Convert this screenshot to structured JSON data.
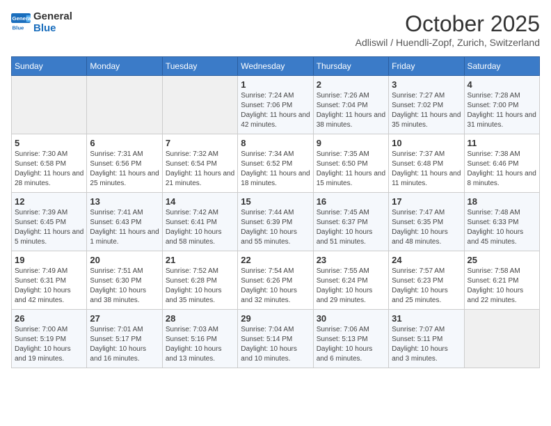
{
  "logo": {
    "general": "General",
    "blue": "Blue"
  },
  "header": {
    "month": "October 2025",
    "location": "Adliswil / Huendli-Zopf, Zurich, Switzerland"
  },
  "weekdays": [
    "Sunday",
    "Monday",
    "Tuesday",
    "Wednesday",
    "Thursday",
    "Friday",
    "Saturday"
  ],
  "weeks": [
    [
      {
        "day": "",
        "info": ""
      },
      {
        "day": "",
        "info": ""
      },
      {
        "day": "",
        "info": ""
      },
      {
        "day": "1",
        "info": "Sunrise: 7:24 AM\nSunset: 7:06 PM\nDaylight: 11 hours and 42 minutes."
      },
      {
        "day": "2",
        "info": "Sunrise: 7:26 AM\nSunset: 7:04 PM\nDaylight: 11 hours and 38 minutes."
      },
      {
        "day": "3",
        "info": "Sunrise: 7:27 AM\nSunset: 7:02 PM\nDaylight: 11 hours and 35 minutes."
      },
      {
        "day": "4",
        "info": "Sunrise: 7:28 AM\nSunset: 7:00 PM\nDaylight: 11 hours and 31 minutes."
      }
    ],
    [
      {
        "day": "5",
        "info": "Sunrise: 7:30 AM\nSunset: 6:58 PM\nDaylight: 11 hours and 28 minutes."
      },
      {
        "day": "6",
        "info": "Sunrise: 7:31 AM\nSunset: 6:56 PM\nDaylight: 11 hours and 25 minutes."
      },
      {
        "day": "7",
        "info": "Sunrise: 7:32 AM\nSunset: 6:54 PM\nDaylight: 11 hours and 21 minutes."
      },
      {
        "day": "8",
        "info": "Sunrise: 7:34 AM\nSunset: 6:52 PM\nDaylight: 11 hours and 18 minutes."
      },
      {
        "day": "9",
        "info": "Sunrise: 7:35 AM\nSunset: 6:50 PM\nDaylight: 11 hours and 15 minutes."
      },
      {
        "day": "10",
        "info": "Sunrise: 7:37 AM\nSunset: 6:48 PM\nDaylight: 11 hours and 11 minutes."
      },
      {
        "day": "11",
        "info": "Sunrise: 7:38 AM\nSunset: 6:46 PM\nDaylight: 11 hours and 8 minutes."
      }
    ],
    [
      {
        "day": "12",
        "info": "Sunrise: 7:39 AM\nSunset: 6:45 PM\nDaylight: 11 hours and 5 minutes."
      },
      {
        "day": "13",
        "info": "Sunrise: 7:41 AM\nSunset: 6:43 PM\nDaylight: 11 hours and 1 minute."
      },
      {
        "day": "14",
        "info": "Sunrise: 7:42 AM\nSunset: 6:41 PM\nDaylight: 10 hours and 58 minutes."
      },
      {
        "day": "15",
        "info": "Sunrise: 7:44 AM\nSunset: 6:39 PM\nDaylight: 10 hours and 55 minutes."
      },
      {
        "day": "16",
        "info": "Sunrise: 7:45 AM\nSunset: 6:37 PM\nDaylight: 10 hours and 51 minutes."
      },
      {
        "day": "17",
        "info": "Sunrise: 7:47 AM\nSunset: 6:35 PM\nDaylight: 10 hours and 48 minutes."
      },
      {
        "day": "18",
        "info": "Sunrise: 7:48 AM\nSunset: 6:33 PM\nDaylight: 10 hours and 45 minutes."
      }
    ],
    [
      {
        "day": "19",
        "info": "Sunrise: 7:49 AM\nSunset: 6:31 PM\nDaylight: 10 hours and 42 minutes."
      },
      {
        "day": "20",
        "info": "Sunrise: 7:51 AM\nSunset: 6:30 PM\nDaylight: 10 hours and 38 minutes."
      },
      {
        "day": "21",
        "info": "Sunrise: 7:52 AM\nSunset: 6:28 PM\nDaylight: 10 hours and 35 minutes."
      },
      {
        "day": "22",
        "info": "Sunrise: 7:54 AM\nSunset: 6:26 PM\nDaylight: 10 hours and 32 minutes."
      },
      {
        "day": "23",
        "info": "Sunrise: 7:55 AM\nSunset: 6:24 PM\nDaylight: 10 hours and 29 minutes."
      },
      {
        "day": "24",
        "info": "Sunrise: 7:57 AM\nSunset: 6:23 PM\nDaylight: 10 hours and 25 minutes."
      },
      {
        "day": "25",
        "info": "Sunrise: 7:58 AM\nSunset: 6:21 PM\nDaylight: 10 hours and 22 minutes."
      }
    ],
    [
      {
        "day": "26",
        "info": "Sunrise: 7:00 AM\nSunset: 5:19 PM\nDaylight: 10 hours and 19 minutes."
      },
      {
        "day": "27",
        "info": "Sunrise: 7:01 AM\nSunset: 5:17 PM\nDaylight: 10 hours and 16 minutes."
      },
      {
        "day": "28",
        "info": "Sunrise: 7:03 AM\nSunset: 5:16 PM\nDaylight: 10 hours and 13 minutes."
      },
      {
        "day": "29",
        "info": "Sunrise: 7:04 AM\nSunset: 5:14 PM\nDaylight: 10 hours and 10 minutes."
      },
      {
        "day": "30",
        "info": "Sunrise: 7:06 AM\nSunset: 5:13 PM\nDaylight: 10 hours and 6 minutes."
      },
      {
        "day": "31",
        "info": "Sunrise: 7:07 AM\nSunset: 5:11 PM\nDaylight: 10 hours and 3 minutes."
      },
      {
        "day": "",
        "info": ""
      }
    ]
  ]
}
